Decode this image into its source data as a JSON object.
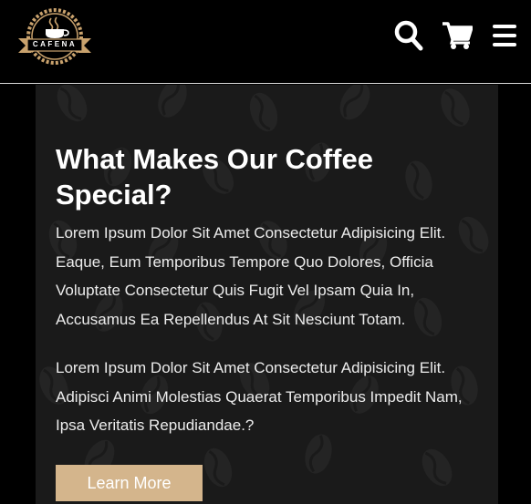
{
  "header": {
    "logo_text": "CAFENA",
    "icons": [
      "search-icon",
      "cart-icon",
      "menu-icon"
    ]
  },
  "section": {
    "heading": "What Makes Our Coffee Special?",
    "paragraphs": [
      "Lorem Ipsum Dolor Sit Amet Consectetur Adipisicing Elit. Eaque, Eum Temporibus Tempore Quo Dolores, Officia Voluptate Consectetur Quis Fugit Vel Ipsam Quia In, Accusamus Ea Repellendus At Sit Nesciunt Totam.",
      "Lorem Ipsum Dolor Sit Amet Consectetur Adipisicing Elit. Adipisci Animi Molestias Quaerat Temporibus Impedit Nam, Ipsa Veritatis Repudiandae.?"
    ],
    "button_label": "Learn More"
  },
  "colors": {
    "background": "#000000",
    "section_bg": "#1a1a1a",
    "accent": "#d4b58c",
    "text": "#ffffff"
  }
}
